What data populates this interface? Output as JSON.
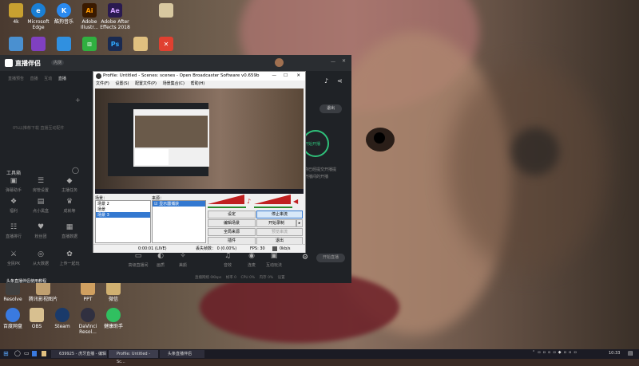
{
  "desktop_icons_top": [
    {
      "label": "4k",
      "color": "#c8a030"
    },
    {
      "label": "Microsoft Edge",
      "color": "#1a7fd4"
    },
    {
      "label": "酷狗音乐",
      "color": "#2a8af0"
    },
    {
      "label": "Adobe Illustr...",
      "color": "#3a1a00"
    },
    {
      "label": "Adobe After Effects 2018",
      "color": "#2a1a50"
    },
    {
      "label": "",
      "color": "#d8c8a0"
    }
  ],
  "desktop_icons_row2": [
    {
      "label": "",
      "color": "#4a90d0"
    },
    {
      "label": "",
      "color": "#8040c0"
    },
    {
      "label": "",
      "color": "#3090e0"
    },
    {
      "label": "",
      "color": "#30b040"
    },
    {
      "label": "",
      "color": "#1a2a50"
    },
    {
      "label": "",
      "color": "#e0c080"
    },
    {
      "label": "",
      "color": "#e04030"
    }
  ],
  "desktop_icons_bottom_row1": [
    {
      "label": "Resolve",
      "color": "#404040"
    },
    {
      "label": "腾讯影视图片",
      "color": "#c0a070"
    },
    {
      "label": "PPT",
      "color": "#d0a060"
    },
    {
      "label": "微信",
      "color": "#d0b070"
    }
  ],
  "desktop_icons_bottom_row2": [
    {
      "label": "百度网盘",
      "color": "#3a7ae0"
    },
    {
      "label": "OBS",
      "color": "#d8c090"
    },
    {
      "label": "Steam",
      "color": "#1a3a6a"
    },
    {
      "label": "DaVinci Resol...",
      "color": "#303040"
    },
    {
      "label": "健康助手",
      "color": "#30c060"
    }
  ],
  "live_app": {
    "logo": "直播伴侣",
    "logo_badge": "内测",
    "tabs": [
      "直播预告",
      "直播",
      "互动",
      "直播"
    ],
    "empty_hint": "0%以推荐下载 直播互动配件",
    "tools_title": "工具箱",
    "tools_row1": [
      "弹幕助手",
      "房管设置",
      "主播任务"
    ],
    "tools_row2": [
      "福利",
      "点小黑盒",
      "成就等"
    ],
    "tools_row3": [
      "直播排行",
      "粉丝团",
      "直播数据"
    ],
    "tools_row4": [
      "全民PK",
      "从大数据",
      "上传一起玩"
    ],
    "bottom_tools": [
      "高级直播间",
      "画质",
      "美颜",
      "音效",
      "连麦",
      "互动玩法"
    ],
    "end_btn": "开始直播",
    "exit_btn": "退出",
    "start_label": "开始开播",
    "side_hint_1": "你已经提交开播提",
    "side_hint_2": "开播间的开播",
    "status_bar": [
      "直播网络 0Kbps",
      "帧率 0",
      "CPU 0%",
      "内存 0%",
      "GPU 0%",
      "网速 0Kbps",
      "设置"
    ],
    "notice": "头条直播伴侣使用教程"
  },
  "obs": {
    "title": "Profile: Untitled - Scenes: scenes - Open Broadcaster Software v0.659b",
    "menu": [
      "文件(F)",
      "设置(S)",
      "配置文件(P)",
      "场景集合(C)",
      "帮助(H)"
    ],
    "scenes_label": "场景：",
    "scenes": [
      "场景 2",
      "场景",
      "场景 3"
    ],
    "sources_label": "来源：",
    "sources": [
      "显示器捕获"
    ],
    "buttons_left": [
      "设定",
      "编辑场景",
      "全局来源",
      "插件"
    ],
    "buttons_right": [
      "停止串流",
      "开始录制",
      "预览串流",
      "退出"
    ],
    "status": [
      "0:00:01 (LIVE)",
      "丢失帧数： 0 (0.00%)",
      "FPS: 30",
      "0kb/s"
    ]
  },
  "taskbar": {
    "items": [
      "639925 - 虎牙直播 - 编辑",
      "Profile: Untitled - Sc...",
      "头条直播伴侣"
    ],
    "clock": "10:33"
  }
}
